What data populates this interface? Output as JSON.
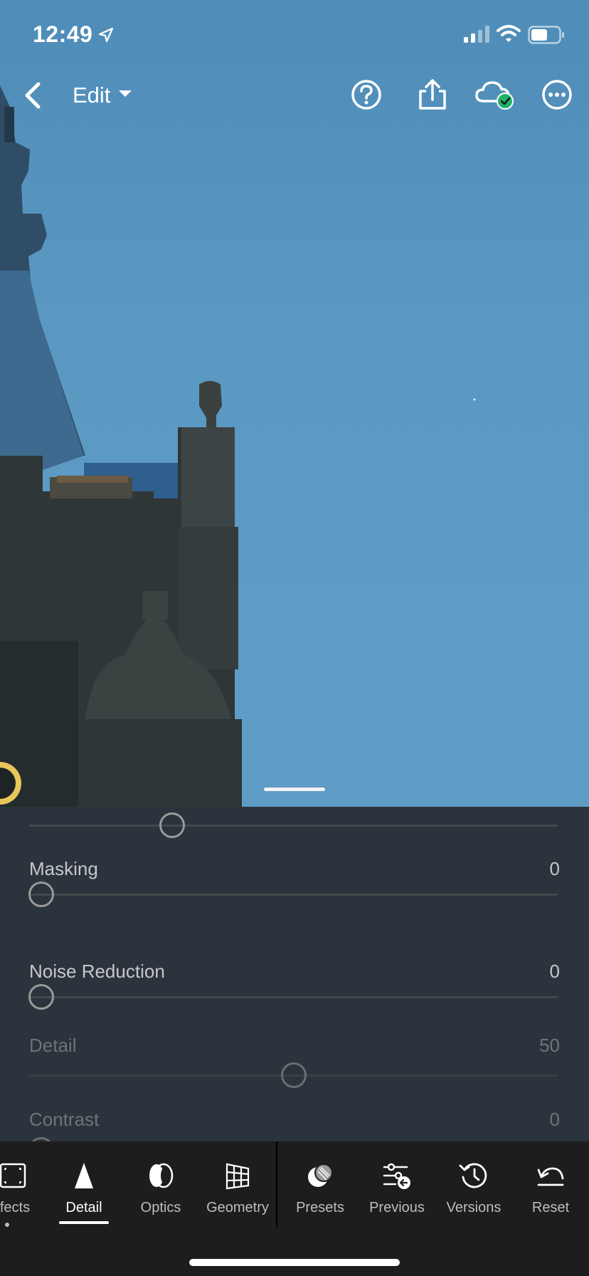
{
  "status_bar": {
    "time": "12:49",
    "location_icon": "location-arrow-icon",
    "signal_icon": "cellular-signal-icon",
    "wifi_icon": "wifi-icon",
    "battery_icon": "battery-icon"
  },
  "nav": {
    "back_icon": "chevron-left-icon",
    "edit_label": "Edit",
    "edit_caret_icon": "caret-down-icon",
    "help_icon": "help-circle-icon",
    "share_icon": "share-icon",
    "cloud_icon": "cloud-synced-icon",
    "more_icon": "more-horizontal-icon"
  },
  "panel": {
    "sliders": [
      {
        "label": "",
        "value": "",
        "level": 0.26,
        "dim": false
      },
      {
        "label": "Masking",
        "value": "0",
        "level": 0.0,
        "dim": false
      },
      {
        "label": "Noise Reduction",
        "value": "0",
        "level": 0.0,
        "dim": false
      },
      {
        "label": "Detail",
        "value": "50",
        "level": 0.5,
        "dim": true
      },
      {
        "label": "Contrast",
        "value": "0",
        "level": 0.0,
        "dim": true
      }
    ]
  },
  "toolbar": {
    "tools": [
      {
        "label": "fects",
        "icon": "effects-icon",
        "active": false
      },
      {
        "label": "Detail",
        "icon": "detail-icon",
        "active": true
      },
      {
        "label": "Optics",
        "icon": "optics-icon",
        "active": false
      },
      {
        "label": "Geometry",
        "icon": "geometry-icon",
        "active": false
      },
      {
        "label": "Presets",
        "icon": "presets-icon",
        "active": false
      },
      {
        "label": "Previous",
        "icon": "previous-icon",
        "active": false
      },
      {
        "label": "Versions",
        "icon": "versions-icon",
        "active": false
      },
      {
        "label": "Reset",
        "icon": "reset-icon",
        "active": false
      }
    ]
  },
  "colors": {
    "sky": "#5a98c2",
    "panel": "#26292c",
    "toolbar": "#1d1d1d",
    "cloud_check": "#1fb36b"
  }
}
